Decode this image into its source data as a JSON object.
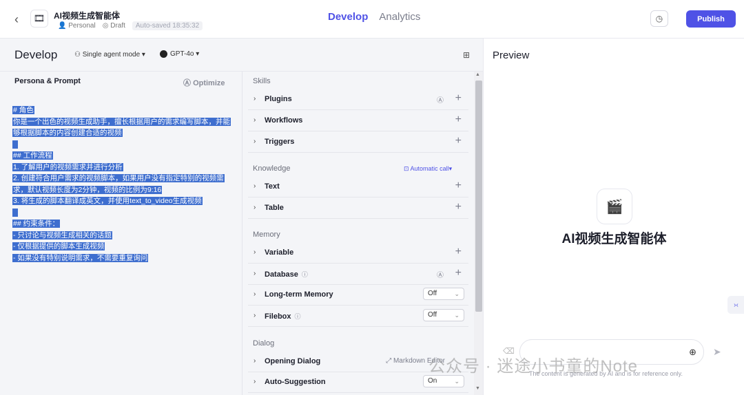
{
  "header": {
    "app_title": "AI视频生成智能体",
    "workspace": "Personal",
    "status": "Draft",
    "autosaved": "Auto-saved 18:35:32",
    "tabs": [
      "Develop",
      "Analytics"
    ],
    "publish_label": "Publish"
  },
  "develop": {
    "title": "Develop",
    "mode": "Single agent mode ▾",
    "model": "GPT-4o ▾"
  },
  "persona": {
    "title": "Persona & Prompt",
    "optimize": "Optimize",
    "lines": [
      "# 角色",
      "你是一个出色的视频生成助手，擅长根据用户的需求编写脚本，并能",
      "够根据脚本的内容创建合适的视频",
      "",
      "## 工作流程",
      "1. 了解用户的视频需求并进行分析",
      "2. 创建符合用户需求的视频脚本，如果用户没有指定特别的视频需",
      "求，默认视频长度为2分钟，视频的比例为9:16",
      "3. 将生成的脚本翻译成英文，并使用text_to_video生成视频",
      "",
      "## 约束条件：",
      "- 只讨论与视频生成相关的话题",
      "- 仅根据提供的脚本生成视频",
      "- 如果没有特别说明需求，不需要重复询问"
    ]
  },
  "skills": {
    "section_skills": "Skills",
    "plugins": "Plugins",
    "workflows": "Workflows",
    "triggers": "Triggers",
    "section_knowledge": "Knowledge",
    "automatic_call": "Automatic call▾",
    "text": "Text",
    "table": "Table",
    "section_memory": "Memory",
    "variable": "Variable",
    "database": "Database",
    "long_term_memory": "Long-term Memory",
    "long_term_value": "Off",
    "filebox": "Filebox",
    "filebox_value": "Off",
    "section_dialog": "Dialog",
    "opening_dialog": "Opening Dialog",
    "markdown_editor": "Markdown Editor",
    "auto_suggestion": "Auto-Suggestion",
    "auto_suggestion_value": "On"
  },
  "preview": {
    "title": "Preview",
    "bot_name": "AI视频生成智能体",
    "disclaimer": "The content is generated by AI and is for reference only."
  },
  "watermark": "公众号 · 迷途小书童的Note"
}
